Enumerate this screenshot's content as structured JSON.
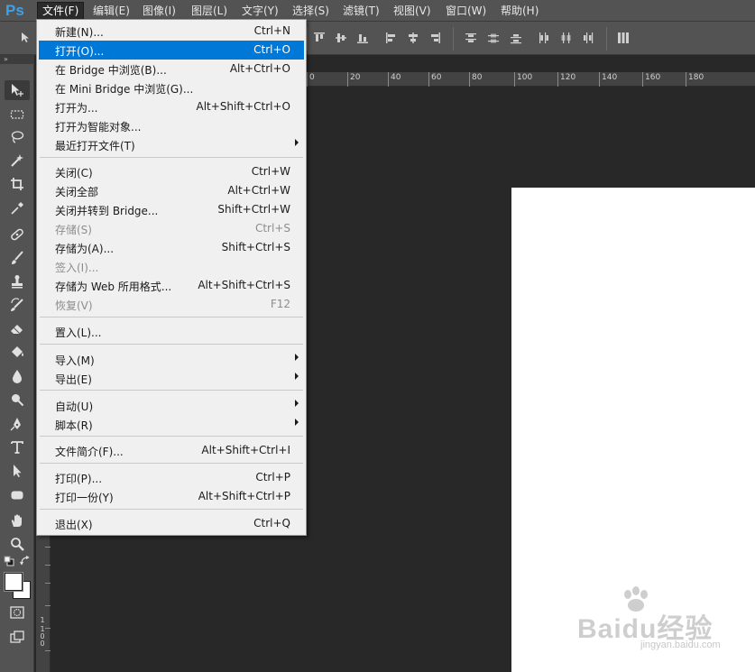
{
  "app": {
    "logo": "Ps"
  },
  "menubar": {
    "items": [
      "文件(F)",
      "编辑(E)",
      "图像(I)",
      "图层(L)",
      "文字(Y)",
      "选择(S)",
      "滤镜(T)",
      "视图(V)",
      "窗口(W)",
      "帮助(H)"
    ],
    "active_index": 0
  },
  "file_menu": {
    "items": [
      {
        "label": "新建(N)...",
        "shortcut": "Ctrl+N",
        "state": "normal"
      },
      {
        "label": "打开(O)...",
        "shortcut": "Ctrl+O",
        "state": "highlighted"
      },
      {
        "label": "在 Bridge 中浏览(B)...",
        "shortcut": "Alt+Ctrl+O",
        "state": "normal"
      },
      {
        "label": "在 Mini Bridge 中浏览(G)...",
        "shortcut": "",
        "state": "normal"
      },
      {
        "label": "打开为...",
        "shortcut": "Alt+Shift+Ctrl+O",
        "state": "normal"
      },
      {
        "label": "打开为智能对象...",
        "shortcut": "",
        "state": "normal"
      },
      {
        "label": "最近打开文件(T)",
        "shortcut": "",
        "state": "submenu"
      },
      {
        "label": "关闭(C)",
        "shortcut": "Ctrl+W",
        "state": "normal"
      },
      {
        "label": "关闭全部",
        "shortcut": "Alt+Ctrl+W",
        "state": "normal"
      },
      {
        "label": "关闭并转到 Bridge...",
        "shortcut": "Shift+Ctrl+W",
        "state": "normal"
      },
      {
        "label": "存储(S)",
        "shortcut": "Ctrl+S",
        "state": "disabled"
      },
      {
        "label": "存储为(A)...",
        "shortcut": "Shift+Ctrl+S",
        "state": "normal"
      },
      {
        "label": "签入(I)...",
        "shortcut": "",
        "state": "disabled"
      },
      {
        "label": "存储为 Web 所用格式...",
        "shortcut": "Alt+Shift+Ctrl+S",
        "state": "normal"
      },
      {
        "label": "恢复(V)",
        "shortcut": "F12",
        "state": "disabled"
      },
      {
        "label": "置入(L)...",
        "shortcut": "",
        "state": "normal"
      },
      {
        "label": "导入(M)",
        "shortcut": "",
        "state": "submenu"
      },
      {
        "label": "导出(E)",
        "shortcut": "",
        "state": "submenu"
      },
      {
        "label": "自动(U)",
        "shortcut": "",
        "state": "submenu"
      },
      {
        "label": "脚本(R)",
        "shortcut": "",
        "state": "submenu"
      },
      {
        "label": "文件简介(F)...",
        "shortcut": "Alt+Shift+Ctrl+I",
        "state": "normal"
      },
      {
        "label": "打印(P)...",
        "shortcut": "Ctrl+P",
        "state": "normal"
      },
      {
        "label": "打印一份(Y)",
        "shortcut": "Alt+Shift+Ctrl+P",
        "state": "normal"
      },
      {
        "label": "退出(X)",
        "shortcut": "Ctrl+Q",
        "state": "normal"
      }
    ]
  },
  "ruler_top": {
    "labels": [
      "0",
      "20",
      "40",
      "60",
      "80",
      "100",
      "120",
      "140",
      "160",
      "180"
    ]
  },
  "ruler_left": {
    "labels": [
      "1",
      "1",
      "0",
      "0"
    ]
  },
  "tools": [
    "move-tool-icon",
    "marquee-tool-icon",
    "lasso-tool-icon",
    "magic-wand-tool-icon",
    "crop-tool-icon",
    "eyedropper-tool-icon",
    "healing-brush-tool-icon",
    "brush-tool-icon",
    "clone-stamp-tool-icon",
    "history-brush-tool-icon",
    "eraser-tool-icon",
    "paint-bucket-tool-icon",
    "blur-tool-icon",
    "dodge-tool-icon",
    "pen-tool-icon",
    "type-tool-icon",
    "path-selection-tool-icon",
    "shape-tool-icon",
    "hand-tool-icon",
    "zoom-tool-icon"
  ],
  "watermark": {
    "text": "Baidu经验",
    "sub": "jingyan.baidu.com"
  },
  "colors": {
    "menu_highlight": "#0078d7",
    "ui_bg": "#535353",
    "workspace": "#282828",
    "logo": "#3fa1e6"
  }
}
